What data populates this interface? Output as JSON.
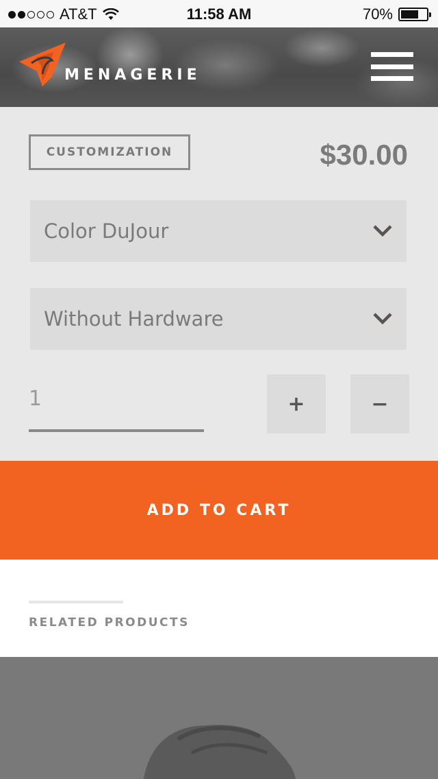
{
  "status_bar": {
    "signal_dots_filled": 2,
    "signal_dots_total": 5,
    "carrier": "AT&T",
    "time": "11:58 AM",
    "battery": "70%",
    "battery_level": 0.7
  },
  "header": {
    "brand": "MENAGERIE",
    "logo_icon": "menagerie-logo-icon",
    "menu_icon": "hamburger-menu-icon",
    "accent_color": "#f26322"
  },
  "product_options": {
    "tag": "CUSTOMIZATION",
    "price": "$30.00",
    "color_select": {
      "value": "Color DuJour",
      "icon": "chevron-down-icon"
    },
    "hardware_select": {
      "value": "Without Hardware",
      "icon": "chevron-down-icon"
    },
    "quantity": "1",
    "increment_label": "+",
    "decrement_label": "−"
  },
  "cart": {
    "button_label": "ADD TO CART",
    "button_color": "#f26322"
  },
  "related": {
    "title": "RELATED PRODUCTS"
  }
}
